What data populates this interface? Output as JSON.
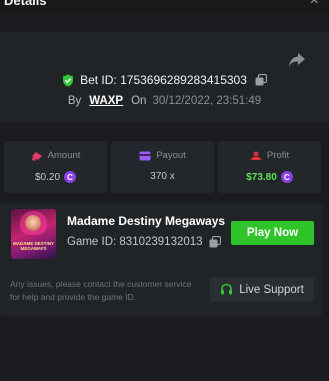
{
  "header": {
    "title": "Details",
    "close_icon": "close-icon"
  },
  "bet": {
    "id_label": "Bet ID: 1753696289283415303",
    "by_label": "By",
    "user": "WAXP",
    "on_label": "On",
    "date": "30/12/2022, 23:51:49"
  },
  "stats": {
    "amount": {
      "label": "Amount",
      "value": "$0.20"
    },
    "payout": {
      "label": "Payout",
      "value": "370 x"
    },
    "profit": {
      "label": "Profit",
      "value": "$73.80"
    },
    "coin_glyph": "C"
  },
  "game": {
    "thumb_text": "MADAME DESTINY MEGAWAYS",
    "name": "Madame Destiny Megaways",
    "id_label": "Game ID: 8310239132013",
    "play_label": "Play Now"
  },
  "support": {
    "issues_text": "Any issues, please contact the customer service for help and provide the game ID.",
    "button_label": "Live Support"
  },
  "colors": {
    "accent_green": "#2fc52a",
    "profit_green": "#5be34f",
    "coin_purple": "#8c3fe8",
    "amount_icon": "#e23e6b",
    "payout_icon": "#9b5cf0",
    "profit_icon": "#e0303c"
  }
}
